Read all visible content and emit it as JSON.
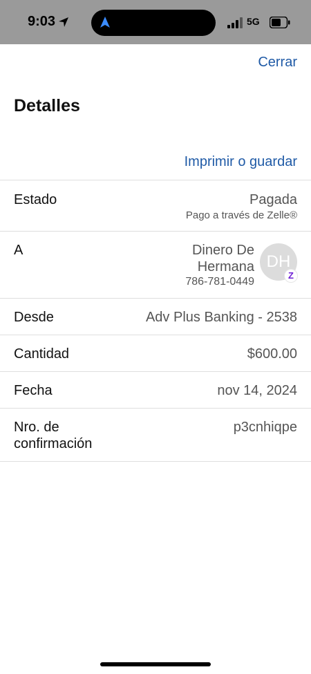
{
  "status_bar": {
    "time": "9:03",
    "network": "5G",
    "icons": [
      "location-arrow-icon",
      "navigation-icon",
      "signal-icon",
      "battery-icon"
    ]
  },
  "header": {
    "close_label": "Cerrar",
    "title": "Detalles",
    "print_label": "Imprimir o guardar"
  },
  "details": {
    "estado": {
      "label": "Estado",
      "value": "Pagada",
      "sub": "Pago a través de Zelle®"
    },
    "a": {
      "label": "A",
      "name_line1": "Dinero De",
      "name_line2": "Hermana",
      "phone": "786-781-0449",
      "avatar_initials": "DH",
      "badge": "Z"
    },
    "desde": {
      "label": "Desde",
      "value": "Adv Plus Banking - 2538"
    },
    "cantidad": {
      "label": "Cantidad",
      "value": "$600.00"
    },
    "fecha": {
      "label": "Fecha",
      "value": "nov 14, 2024"
    },
    "confirmacion": {
      "label_line1": "Nro. de",
      "label_line2": "confirmación",
      "value": "p3cnhiqpe"
    }
  },
  "colors": {
    "accent": "#1f5aa6",
    "zelle": "#6d1ed4",
    "status_bar_bg": "#9a9a9a"
  }
}
